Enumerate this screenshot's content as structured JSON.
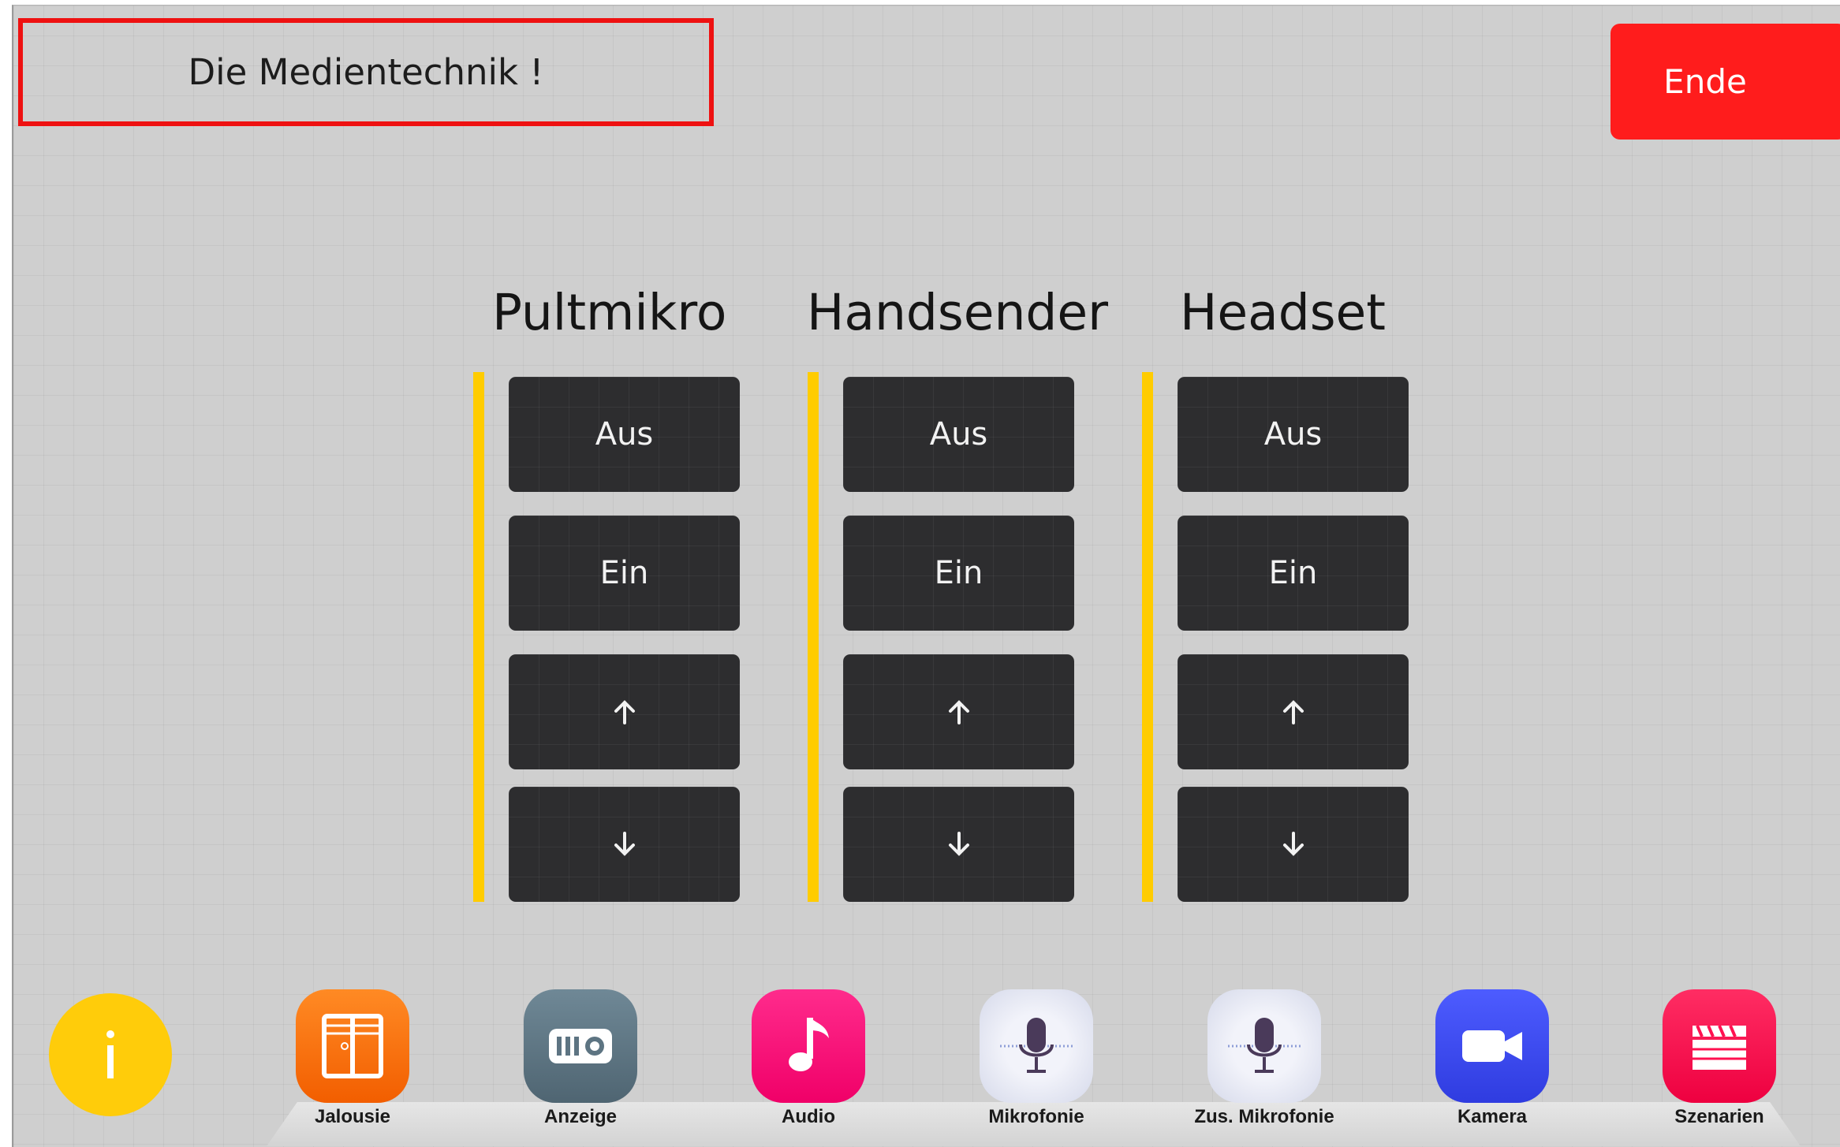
{
  "header": {
    "title": "Die Medientechnik !",
    "end_label": "Ende"
  },
  "columns": [
    {
      "title": "Pultmikro",
      "off_label": "Aus",
      "on_label": "Ein"
    },
    {
      "title": "Handsender",
      "off_label": "Aus",
      "on_label": "Ein"
    },
    {
      "title": "Headset",
      "off_label": "Aus",
      "on_label": "Ein"
    }
  ],
  "dock": {
    "info_label": "i",
    "items": [
      {
        "label": "Jalousie",
        "icon": "blinds-icon",
        "color": "#ff6a00"
      },
      {
        "label": "Anzeige",
        "icon": "projector-icon",
        "color": "#5d7482"
      },
      {
        "label": "Audio",
        "icon": "music-note-icon",
        "color": "#ff0a78"
      },
      {
        "label": "Mikrofonie",
        "icon": "microphone-icon",
        "color": "#dfe2ee"
      },
      {
        "label": "Zus. Mikrofonie",
        "icon": "microphone-icon",
        "color": "#dfe2ee"
      },
      {
        "label": "Kamera",
        "icon": "video-camera-icon",
        "color": "#3f4cf0"
      },
      {
        "label": "Szenarien",
        "icon": "clapperboard-icon",
        "color": "#ff1050"
      }
    ]
  },
  "colors": {
    "accent_bar": "#ffcc00",
    "button_bg": "#2d2d2f",
    "end_bg": "#ff1c1c",
    "title_border": "#ee1111"
  }
}
